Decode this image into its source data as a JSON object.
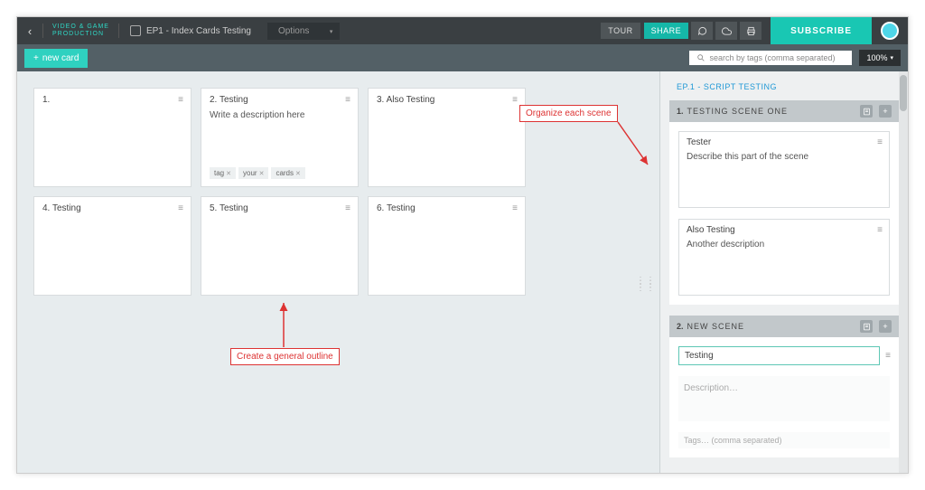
{
  "logo": {
    "line1": "VIDEO & GAME",
    "line2": "PRODUCTION"
  },
  "doc_title": "EP1 - Index Cards Testing",
  "options_label": "Options",
  "topbar": {
    "tour": "TOUR",
    "share": "SHARE",
    "subscribe": "SUBSCRIBE"
  },
  "toolbar": {
    "new_card": "new card",
    "search_placeholder": "search by tags (comma separated)",
    "zoom": "100%"
  },
  "cards": [
    {
      "num": "1.",
      "title": ""
    },
    {
      "num": "2.",
      "title": "Testing",
      "desc": "Write a description here",
      "tags": [
        "tag",
        "your",
        "cards"
      ]
    },
    {
      "num": "3.",
      "title": "Also Testing"
    },
    {
      "num": "4.",
      "title": "Testing"
    },
    {
      "num": "5.",
      "title": "Testing"
    },
    {
      "num": "6.",
      "title": "Testing"
    }
  ],
  "annot": {
    "organize": "Organize each scene",
    "outline": "Create a general outline"
  },
  "right": {
    "episode": "EP.1 - SCRIPT TESTING",
    "scenes": [
      {
        "num": "1.",
        "title": "TESTING SCENE ONE",
        "items": [
          {
            "title": "Tester",
            "desc": "Describe this part of the scene"
          },
          {
            "title": "Also Testing",
            "desc": "Another description"
          }
        ]
      },
      {
        "num": "2.",
        "title": "NEW SCENE",
        "input": {
          "title": "Testing",
          "desc_ph": "Description…",
          "tags_ph": "Tags… (comma separated)"
        }
      }
    ]
  }
}
